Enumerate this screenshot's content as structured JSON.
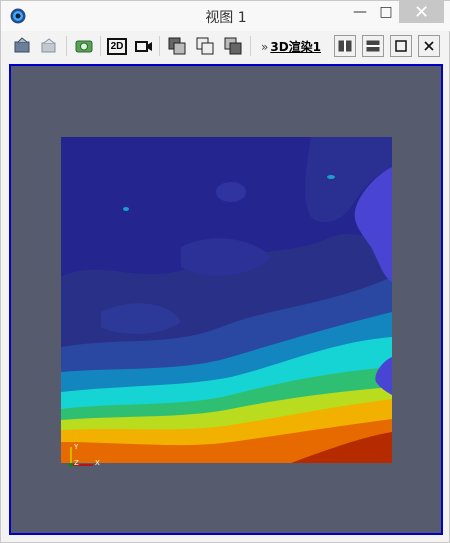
{
  "window": {
    "title": "视图 1",
    "controls": {
      "minimize": "—",
      "maximize": "□",
      "close": "✕"
    }
  },
  "toolbar": {
    "view_label": "3D渲染1",
    "chevron": "»",
    "buttons": [
      "reset-camera",
      "undo-camera",
      "screenshot",
      "2d-mode",
      "record",
      "split-a",
      "split-b",
      "split-c"
    ],
    "mode_2d_label": "2D"
  },
  "axes": {
    "y": "Y",
    "z": "Z",
    "x": "X"
  },
  "colors": {
    "viewport_bg": "#565b6d",
    "frame": "#0000c8"
  }
}
